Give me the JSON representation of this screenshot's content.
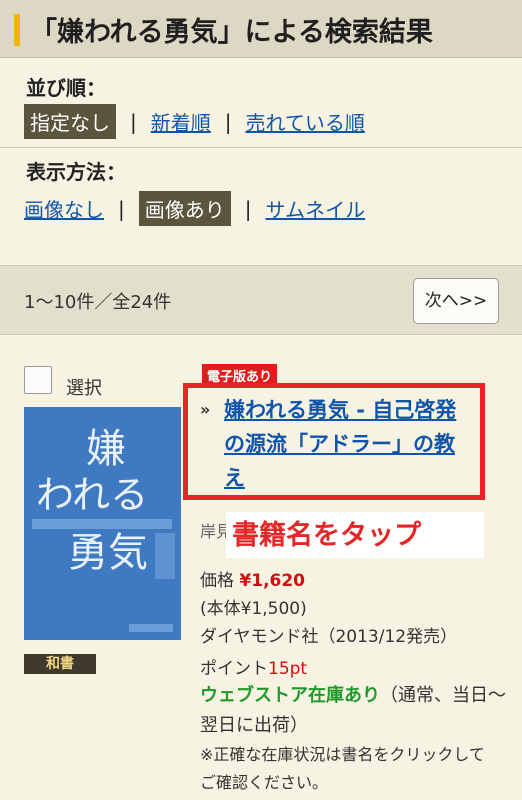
{
  "header": {
    "title": "「嫌われる勇気」による検索結果"
  },
  "sort": {
    "label": "並び順：",
    "options": [
      "指定なし",
      "新着順",
      "売れている順"
    ]
  },
  "display": {
    "label": "表示方法：",
    "options": [
      "画像なし",
      "画像あり",
      "サムネイル"
    ]
  },
  "separator": "|",
  "pager": {
    "count": "1〜10件／全24件",
    "next_label": "次へ>>"
  },
  "result": {
    "select_label": "選択",
    "cover_lines": [
      "嫌",
      "われる",
      "勇気"
    ],
    "category_badge": "和書",
    "ebook_badge": "電子版あり",
    "title_chevron": "»",
    "title": "嫌われる勇気 - 自己啓発の源流「アドラー」の教え",
    "author_visible": "岸見",
    "annotation": "書籍名をタップ",
    "price_label": "価格",
    "price": "¥1,620",
    "price_base": "(本体¥1,500)",
    "publisher": "ダイヤモンド社（2013/12発売）",
    "point_label": "ポイント",
    "point": "15pt",
    "stock_status": "ウェブストア在庫あり",
    "stock_detail": "（通常、当日〜翌日に出荷）",
    "stock_note": "※正確な在庫状況は書名をクリックしてご確認ください。"
  },
  "colors": {
    "accent_bar": "#f2b400",
    "selected_bg": "#5a553c",
    "link": "#1155aa",
    "highlight": "#e62626",
    "stock_ok": "#1f9a2a",
    "cover": "#3f79c2"
  }
}
